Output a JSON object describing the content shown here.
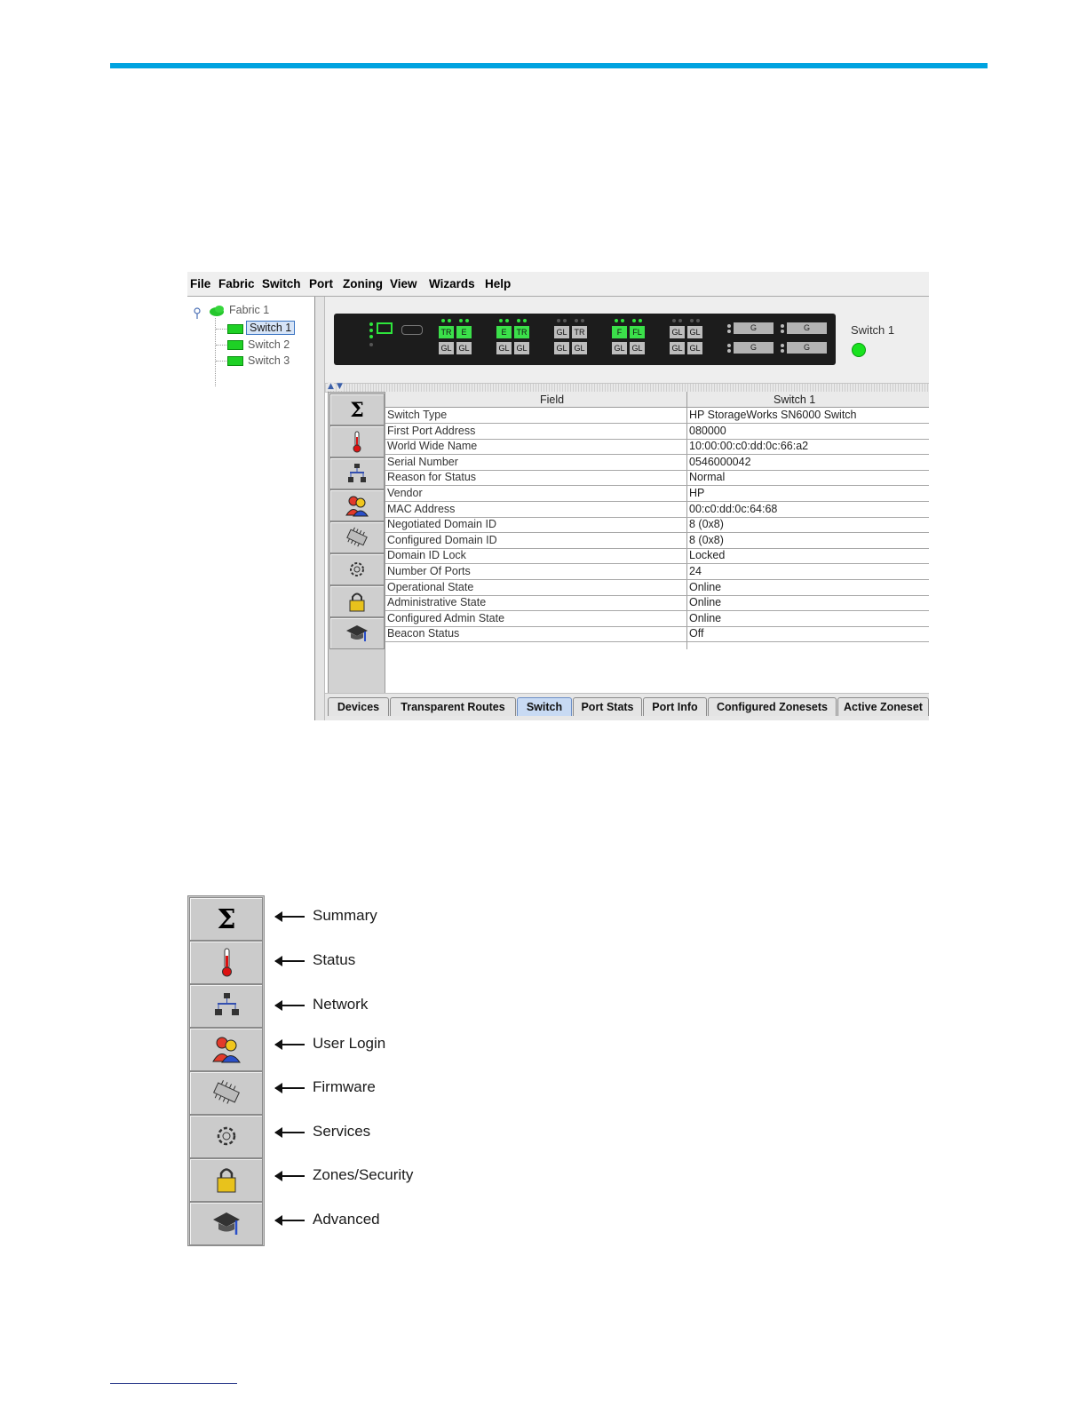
{
  "menu": [
    "File",
    "Fabric",
    "Switch",
    "Port",
    "Zoning",
    "View",
    "Wizards",
    "Help"
  ],
  "tree": {
    "fabric": "Fabric 1",
    "switches": [
      "Switch 1",
      "Switch 2",
      "Switch 3"
    ],
    "selected": "Switch 1"
  },
  "faceplate": {
    "switch_name": "Switch 1",
    "port_groups": [
      {
        "top": [
          "TR",
          "E"
        ],
        "bottom": [
          "GL",
          "GL"
        ],
        "top_active": true
      },
      {
        "top": [
          "E",
          "TR"
        ],
        "bottom": [
          "GL",
          "GL"
        ],
        "top_active": true
      },
      {
        "top": [
          "GL",
          "TR"
        ],
        "bottom": [
          "GL",
          "GL"
        ],
        "top_active": false
      },
      {
        "top": [
          "F",
          "FL"
        ],
        "bottom": [
          "GL",
          "GL"
        ],
        "top_active": true
      },
      {
        "top": [
          "GL",
          "GL"
        ],
        "bottom": [
          "GL",
          "GL"
        ],
        "top_active": false
      }
    ],
    "sfp_ports": [
      "G",
      "G",
      "G",
      "G"
    ],
    "colors": {
      "active_port": "#3be04a",
      "status_led": "#19e21f"
    }
  },
  "table": {
    "headers": [
      "Field",
      "Switch 1"
    ],
    "rows": [
      [
        "Switch Type",
        "HP StorageWorks SN6000 Switch"
      ],
      [
        "First Port Address",
        "080000"
      ],
      [
        "World Wide Name",
        "10:00:00:c0:dd:0c:66:a2"
      ],
      [
        "Serial Number",
        "0546000042"
      ],
      [
        "Reason for Status",
        "Normal"
      ],
      [
        "Vendor",
        "HP"
      ],
      [
        "MAC Address",
        "00:c0:dd:0c:64:68"
      ],
      [
        "Negotiated Domain ID",
        "8 (0x8)"
      ],
      [
        "Configured Domain ID",
        "8 (0x8)"
      ],
      [
        "Domain ID Lock",
        "Locked"
      ],
      [
        "Number Of Ports",
        "24"
      ],
      [
        "Operational State",
        "Online"
      ],
      [
        "Administrative State",
        "Online"
      ],
      [
        "Configured Admin State",
        "Online"
      ],
      [
        "Beacon Status",
        "Off"
      ]
    ]
  },
  "tabs": {
    "items": [
      "Devices",
      "Transparent Routes",
      "Switch",
      "Port Stats",
      "Port Info",
      "Configured Zonesets",
      "Active Zoneset"
    ],
    "active": "Switch"
  },
  "icons": [
    {
      "icon": "sigma-icon",
      "label": "Summary"
    },
    {
      "icon": "thermometer-icon",
      "label": "Status"
    },
    {
      "icon": "network-icon",
      "label": "Network"
    },
    {
      "icon": "users-icon",
      "label": "User Login"
    },
    {
      "icon": "chip-icon",
      "label": "Firmware"
    },
    {
      "icon": "gear-icon",
      "label": "Services"
    },
    {
      "icon": "padlock-icon",
      "label": "Zones/Security"
    },
    {
      "icon": "graduation-cap-icon",
      "label": "Advanced"
    }
  ],
  "colors": {
    "accent_rule": "#00a3e0",
    "active_tab": "#c8daf3"
  }
}
